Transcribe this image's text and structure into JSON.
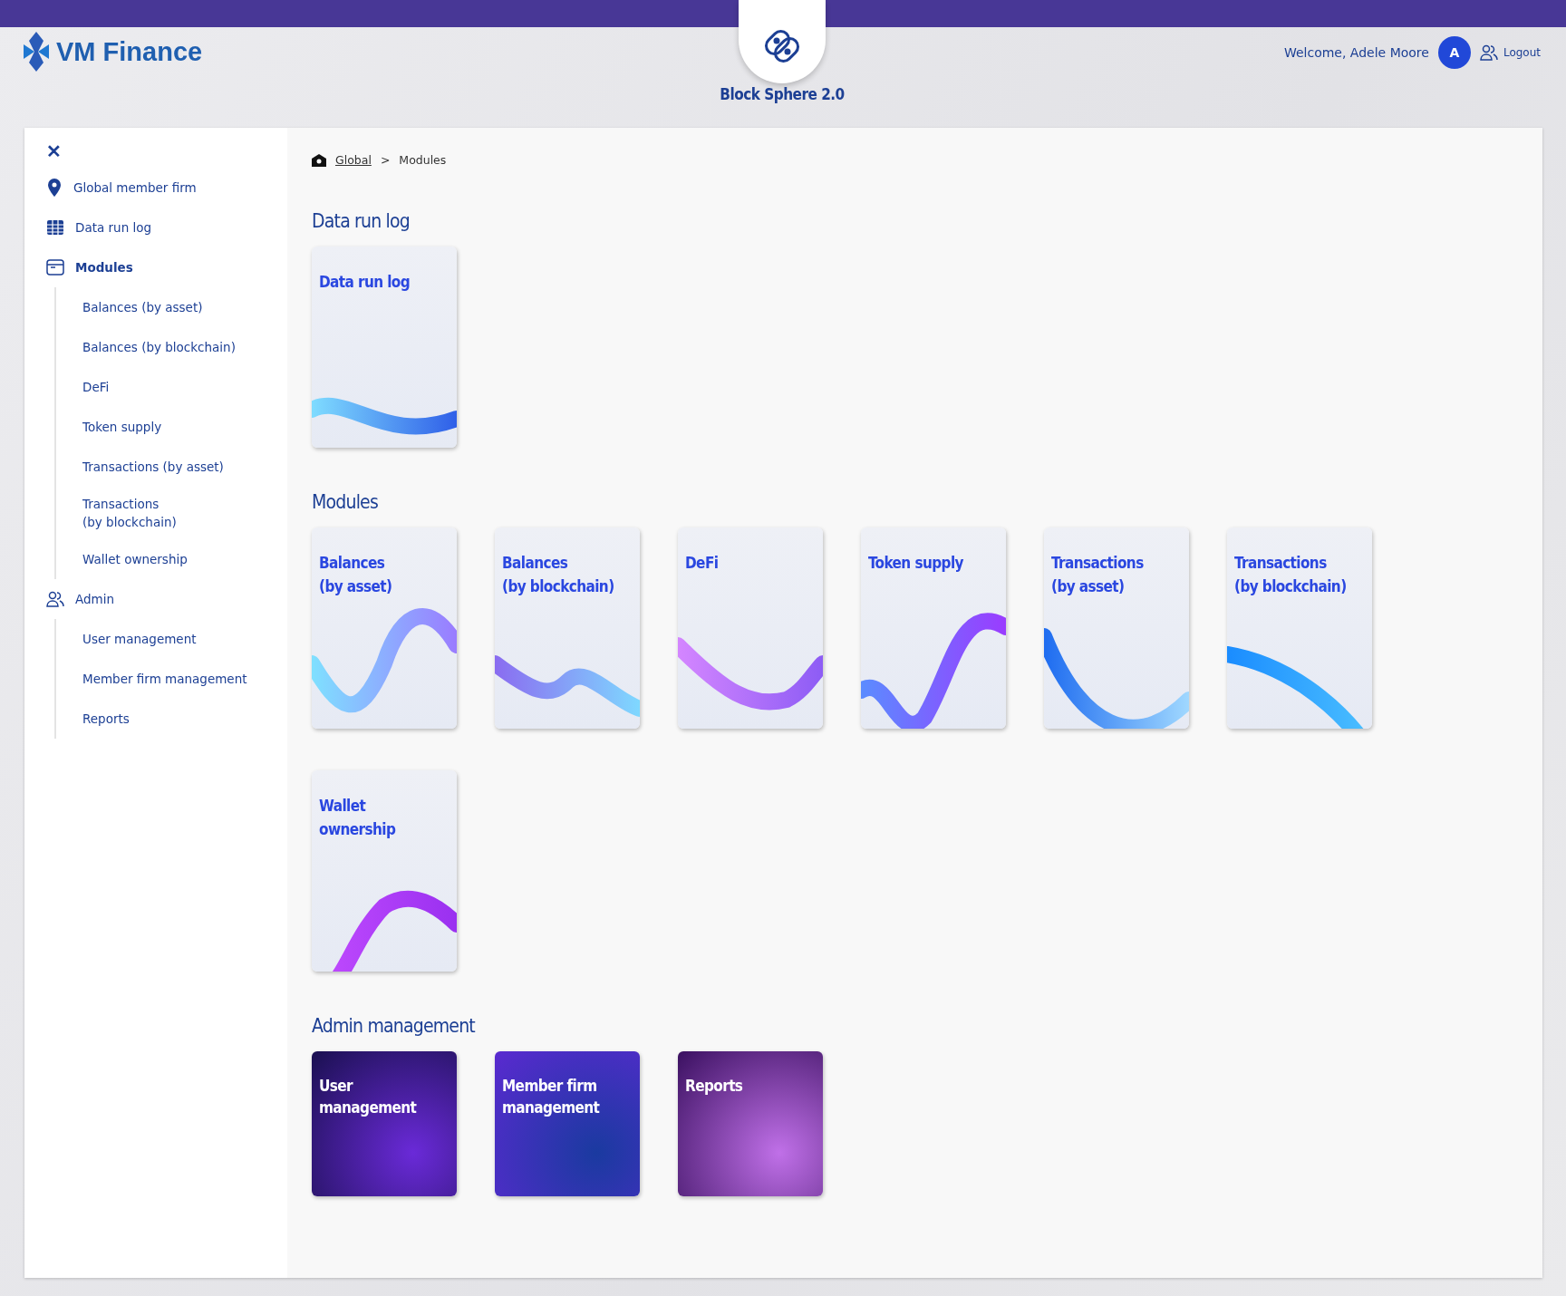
{
  "brand": {
    "name": "VM Finance"
  },
  "product": {
    "name": "Block Sphere 2.0"
  },
  "user": {
    "welcome": "Welcome, Adele Moore",
    "avatar": "A",
    "logout": "Logout"
  },
  "sidebar": {
    "close": "✕",
    "items": [
      {
        "label": "Global member firm",
        "selected": false
      },
      {
        "label": "Data run log",
        "selected": false
      },
      {
        "label": "Modules",
        "selected": true,
        "children": [
          {
            "label": "Balances (by asset)"
          },
          {
            "label": "Balances (by blockchain)"
          },
          {
            "label": "DeFi"
          },
          {
            "label": "Token supply"
          },
          {
            "label": "Transactions (by asset)"
          },
          {
            "label": "Transactions\n(by blockchain)"
          },
          {
            "label": "Wallet ownership"
          }
        ]
      },
      {
        "label": "Admin",
        "selected": false,
        "children": [
          {
            "label": "User management"
          },
          {
            "label": "Member firm management"
          },
          {
            "label": "Reports"
          }
        ]
      }
    ]
  },
  "breadcrumb": {
    "link": "Global",
    "separator": ">",
    "current": "Modules"
  },
  "sections": [
    {
      "title": "Data run log",
      "kind": "light",
      "cards": [
        {
          "title": "Data run log"
        }
      ]
    },
    {
      "title": "Modules",
      "kind": "light",
      "cards": [
        {
          "title": "Balances\n(by asset)"
        },
        {
          "title": "Balances\n(by blockchain)"
        },
        {
          "title": "DeFi"
        },
        {
          "title": "Token supply"
        },
        {
          "title": "Transactions\n(by asset)"
        },
        {
          "title": "Transactions\n(by blockchain)"
        },
        {
          "title": "Wallet\nownership"
        }
      ]
    },
    {
      "title": "Admin management",
      "kind": "dark",
      "cards": [
        {
          "title": "User\nmanagement"
        },
        {
          "title": "Member firm\nmanagement"
        },
        {
          "title": "Reports"
        }
      ]
    }
  ]
}
